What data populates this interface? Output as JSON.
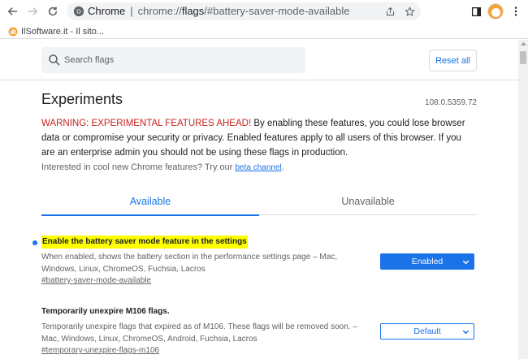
{
  "browser": {
    "omnibox": {
      "site_label": "Chrome",
      "separator": "|",
      "url_prefix": "chrome://",
      "url_host": "flags",
      "url_rest": "/#battery-saver-mode-available"
    },
    "bookmark": {
      "label": "IlSoftware.it - Il sito..."
    }
  },
  "header": {
    "search_placeholder": "Search flags",
    "reset_label": "Reset all"
  },
  "page": {
    "title": "Experiments",
    "version": "108.0.5359.72",
    "warning_prefix": "WARNING: EXPERIMENTAL FEATURES AHEAD!",
    "warning_body": " By enabling these features, you could lose browser data or compromise your security or privacy. Enabled features apply to all users of this browser. If you are an enterprise admin you should not be using these flags in production.",
    "interest_text": "Interested in cool new Chrome features? Try our ",
    "interest_link": "beta channel",
    "interest_suffix": "."
  },
  "tabs": [
    {
      "label": "Available",
      "active": true
    },
    {
      "label": "Unavailable",
      "active": false
    }
  ],
  "flags": [
    {
      "title": "Enable the battery saver mode feature in the settings",
      "description": "When enabled, shows the battery section in the performance settings page – Mac, Windows, Linux, ChromeOS, Fuchsia, Lacros",
      "link": "#battery-saver-mode-available",
      "selected": "Enabled",
      "highlighted": true
    },
    {
      "title": "Temporarily unexpire M106 flags.",
      "description": "Temporarily unexpire flags that expired as of M106. These flags will be removed soon. – Mac, Windows, Linux, ChromeOS, Android, Fuchsia, Lacros",
      "link": "#temporary-unexpire-flags-m106",
      "selected": "Default",
      "highlighted": false
    }
  ],
  "colors": {
    "accent": "#1a73e8",
    "warning": "#c5221f",
    "highlight": "#ffff00"
  }
}
